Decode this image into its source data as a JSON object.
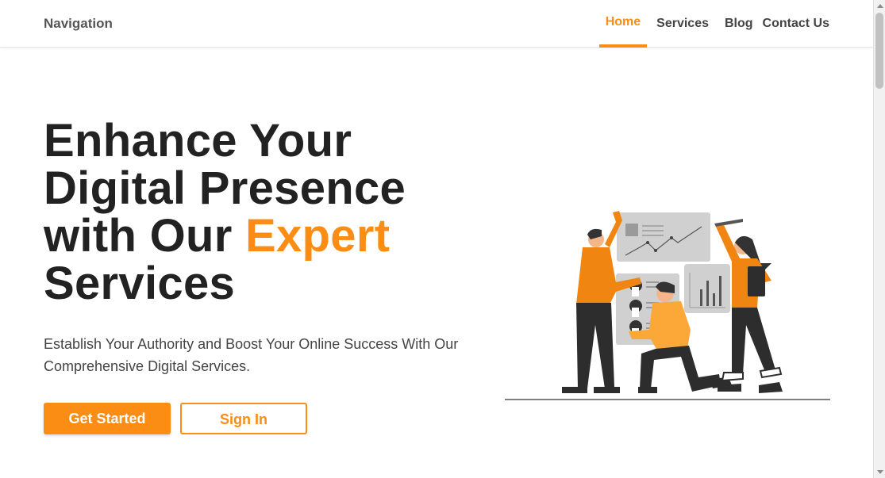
{
  "nav": {
    "brand": "Navigation",
    "links": [
      {
        "label": "Home",
        "active": true
      },
      {
        "label": "Services",
        "active": false
      },
      {
        "label": "Blog",
        "active": false
      },
      {
        "label": "Contact Us",
        "active": false
      }
    ]
  },
  "hero": {
    "title_line1": "Enhance Your",
    "title_line2": "Digital Presence",
    "title_line3_start": "with Our ",
    "title_line3_accent": "Expert",
    "title_line4": "Services",
    "subtitle": "Establish Your Authority and Boost Your Online Success With Our Comprehensive Digital Services.",
    "primary_button": "Get Started",
    "secondary_button": "Sign In"
  },
  "illustration": {
    "name": "team-analytics-illustration"
  },
  "colors": {
    "accent": "#fb8c14",
    "text_dark": "#222222",
    "text_muted": "#444444"
  }
}
